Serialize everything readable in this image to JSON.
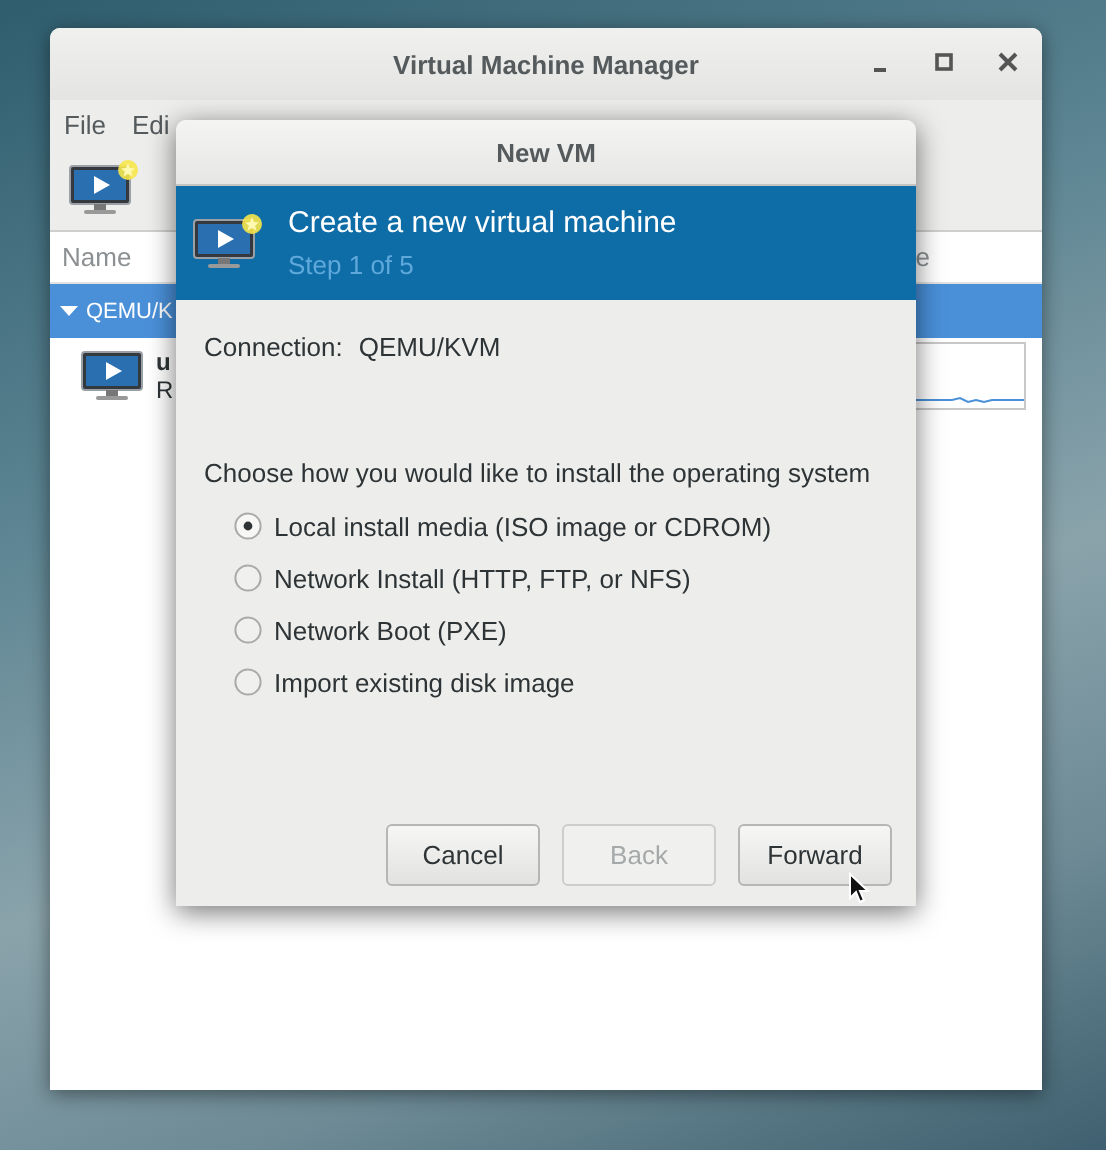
{
  "main_window": {
    "title": "Virtual Machine Manager",
    "menu": [
      "File",
      "Edi"
    ],
    "columns": [
      "Name",
      "e"
    ],
    "groups": [
      {
        "label": "QEMU/K",
        "expanded": true,
        "selected": true,
        "vms": [
          {
            "name": "u",
            "status": "R"
          }
        ]
      }
    ]
  },
  "dialog": {
    "title": "New VM",
    "header": {
      "title": "Create a new virtual machine",
      "step": "Step 1 of 5"
    },
    "connection": {
      "label": "Connection:",
      "value": "QEMU/KVM"
    },
    "prompt": "Choose how you would like to install the operating system",
    "options": [
      {
        "label": "Local install media (ISO image or CDROM)",
        "selected": true
      },
      {
        "label": "Network Install (HTTP, FTP, or NFS)",
        "selected": false
      },
      {
        "label": "Network Boot (PXE)",
        "selected": false
      },
      {
        "label": "Import existing disk image",
        "selected": false
      }
    ],
    "buttons": [
      {
        "label": "Cancel",
        "disabled": false
      },
      {
        "label": "Back",
        "disabled": true
      },
      {
        "label": "Forward",
        "disabled": false
      }
    ]
  }
}
